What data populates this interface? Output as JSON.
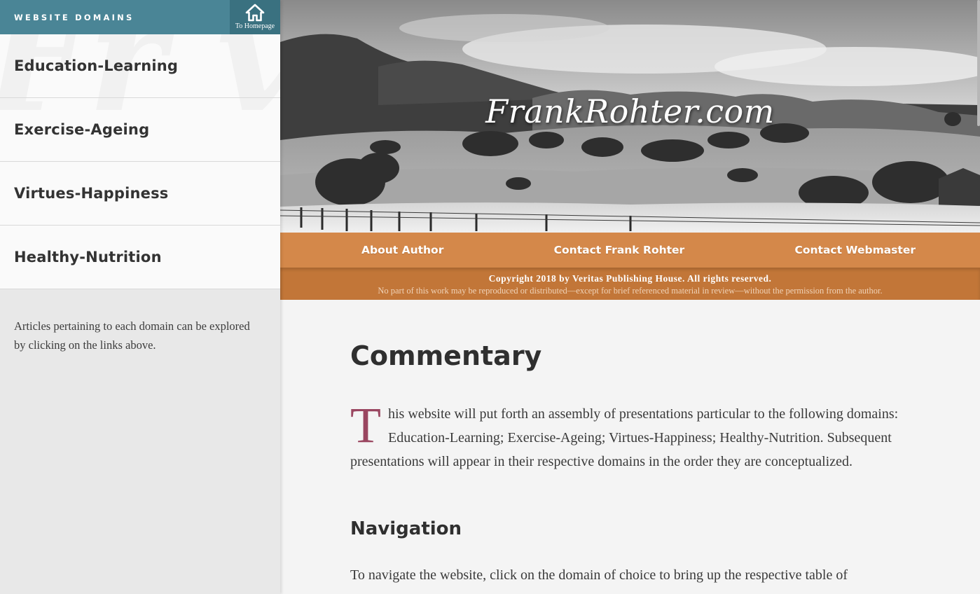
{
  "sidebar": {
    "title": "WEBSITE DOMAINS",
    "home_label": "To Homepage",
    "watermark": "Fr ve",
    "items": [
      {
        "label": "Education-Learning"
      },
      {
        "label": "Exercise-Ageing"
      },
      {
        "label": "Virtues-Happiness"
      },
      {
        "label": "Healthy-Nutrition"
      }
    ],
    "note": "Articles pertaining to each domain can be explored by clicking on the links above."
  },
  "header": {
    "site_title": "FrankRohter.com"
  },
  "nav": {
    "items": [
      {
        "label": "About Author"
      },
      {
        "label": "Contact Frank Rohter"
      },
      {
        "label": "Contact Webmaster"
      }
    ]
  },
  "copyright": {
    "line1": "Copyright 2018 by Veritas Publishing House. All rights reserved.",
    "line2": "No part of this work may be reproduced or distributed—except for brief referenced material in review—without the permission from the author."
  },
  "content": {
    "heading": "Commentary",
    "intro_dropcap": "T",
    "intro_text": "his website will put forth an assembly of presentations particular to the following domains: Education-Learning; Exercise-Ageing; Virtues-Happiness; Healthy-Nutrition. Subsequent presentations will appear in their respective domains in the order they are conceptualized.",
    "nav_heading": "Navigation",
    "nav_text": "To navigate the website, click on the domain of choice to bring up the respective table of"
  },
  "colors": {
    "sidebar_header": "#4a8596",
    "nav_bar": "#d4884a",
    "copyright_bar": "#c27638",
    "dropcap": "#9a4660"
  },
  "icons": {
    "home": "home-icon"
  }
}
